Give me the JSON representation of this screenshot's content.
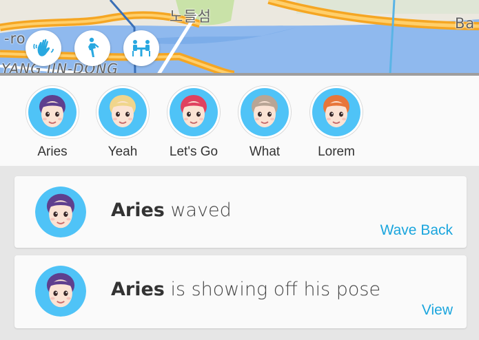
{
  "map": {
    "labels": [
      "-ro",
      "노들섬",
      "YANG JIN-DONG",
      "Ba"
    ],
    "actions": [
      {
        "name": "wave-action-button",
        "icon": "wave-hand-icon"
      },
      {
        "name": "pose-action-button",
        "icon": "pose-figure-icon"
      },
      {
        "name": "hangout-action-button",
        "icon": "table-chairs-icon"
      }
    ]
  },
  "friends": [
    {
      "name": "Aries",
      "hair": "#5e3f8e",
      "bg": "#4fc3f7"
    },
    {
      "name": "Yeah",
      "hair": "#f0d58c",
      "bg": "#4fc3f7"
    },
    {
      "name": "Let's Go",
      "hair": "#e0415f",
      "bg": "#4fc3f7"
    },
    {
      "name": "What",
      "hair": "#b8a595",
      "bg": "#4fc3f7"
    },
    {
      "name": "Lorem",
      "hair": "#e8763a",
      "bg": "#4fc3f7"
    }
  ],
  "notifications": [
    {
      "user": "Aries",
      "text": " waved",
      "action": "Wave Back"
    },
    {
      "user": "Aries",
      "text": " is showing off his pose",
      "action": "View"
    }
  ],
  "colors": {
    "accent": "#1aa5dd",
    "avatar_bg": "#4fc3f7"
  }
}
